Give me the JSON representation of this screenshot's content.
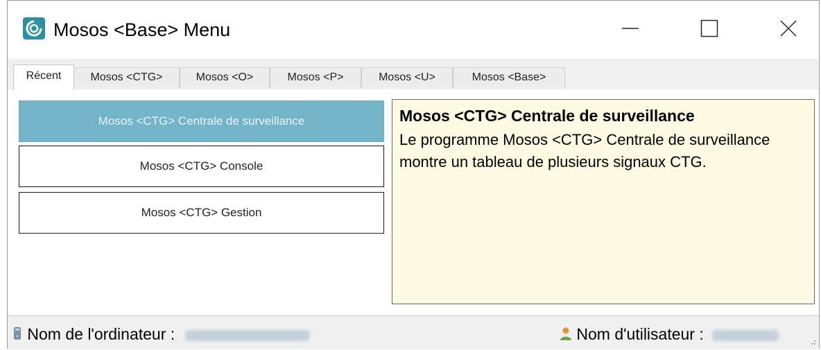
{
  "window": {
    "title": "Mosos <Base> Menu",
    "app_icon": "mosos-logo-icon",
    "controls": {
      "minimize": "—",
      "maximize": "☐",
      "close": "✕"
    }
  },
  "tabs": [
    {
      "label": "Récent",
      "active": true
    },
    {
      "label": "Mosos <CTG>",
      "active": false
    },
    {
      "label": "Mosos <O>",
      "active": false
    },
    {
      "label": "Mosos <P>",
      "active": false
    },
    {
      "label": "Mosos <U>",
      "active": false
    },
    {
      "label": "Mosos <Base>",
      "active": false
    }
  ],
  "menu_items": [
    {
      "label": "Mosos <CTG> Centrale de surveillance",
      "selected": true
    },
    {
      "label": "Mosos <CTG> Console",
      "selected": false
    },
    {
      "label": "Mosos <CTG> Gestion",
      "selected": false
    }
  ],
  "description": {
    "title": "Mosos <CTG> Centrale de surveillance",
    "body": "Le programme Mosos <CTG> Centrale de surveillance montre un tableau de plusieurs signaux CTG."
  },
  "statusbar": {
    "computer_label": "Nom de l'ordinateur :",
    "computer_icon": "computer-icon",
    "user_label": "Nom d'utilisateur :",
    "user_icon": "user-icon"
  },
  "colors": {
    "accent": "#73b4c9",
    "app_icon_bg": "#2e8fa0",
    "description_bg": "#fdfbe3"
  }
}
